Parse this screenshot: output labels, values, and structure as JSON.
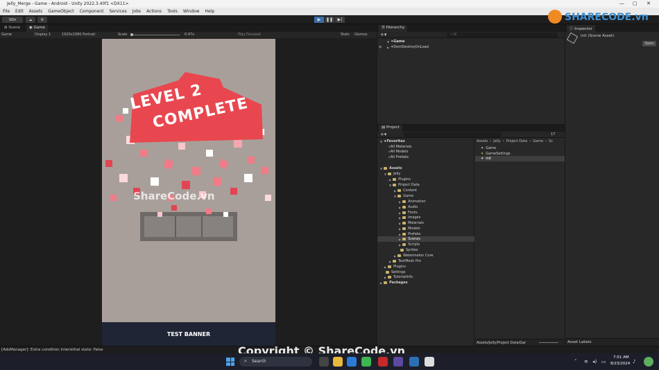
{
  "window": {
    "title": "Jelly_Merge - Game - Android - Unity 2022.3.40f1 <DX11>"
  },
  "menu": [
    "File",
    "Edit",
    "Assets",
    "GameObject",
    "Component",
    "Services",
    "Jobs",
    "Actions",
    "Tools",
    "Window",
    "Help"
  ],
  "toolbar": {
    "account": "ND"
  },
  "scene_tabs": {
    "scene": "Scene",
    "game": "Game"
  },
  "game_bar": {
    "mode": "Game",
    "display": "Display 1",
    "resolution": "1920x1080 Portrait",
    "scale_label": "Scale",
    "scale_value": "0.47x",
    "play_focused": "Play Focused",
    "stats": "Stats",
    "gizmos": "Gizmos"
  },
  "game_view": {
    "banner": "TEST BANNER",
    "level_line1": "LEVEL 2",
    "level_line2": "COMPLETE",
    "watermark": "ShareCode.vn"
  },
  "hierarchy": {
    "title": "Hierarchy",
    "search_placeholder": "All",
    "items": [
      "Game",
      "DontDestroyOnLoad"
    ]
  },
  "inspector": {
    "title": "Inspector",
    "asset": "init (Scene Asset)",
    "open_label": "Open",
    "labels_title": "Asset Labels"
  },
  "project": {
    "title": "Project",
    "count": "17",
    "favorites_label": "Favorites",
    "favorites": [
      "All Materials",
      "All Models",
      "All Prefabs"
    ],
    "assets_label": "Assets",
    "tree": [
      "Jelly",
      "Plugins",
      "Project Data",
      "Content",
      "Game",
      "Animation",
      "Audio",
      "Fonts",
      "Images",
      "Materials",
      "Models",
      "Prefabs",
      "Scenes",
      "Scripts",
      "Sprites",
      "Watermelon Core",
      "TextMesh Pro",
      "Plugins",
      "Settings",
      "TutorialInfo"
    ],
    "packages_label": "Packages",
    "breadcrumb": [
      "Assets",
      "Jelly",
      "Project Data",
      "Game",
      "Sc"
    ],
    "files": [
      "Game",
      "GameSettings",
      "init"
    ],
    "footer_path": "Assets/Jelly/Project Data/Gar"
  },
  "status": {
    "message": "[AdsManager]: Extra condition interstitial state: False"
  },
  "footer_watermark": "Copyright © ShareCode.vn",
  "logo": {
    "text": "SHARECODE.vn"
  },
  "taskbar": {
    "search": "Search",
    "time": "7:51 AM",
    "date": "8/23/2024"
  },
  "colors": {
    "accent": "#e8474f",
    "selection": "#2c5d87",
    "folder": "#c8b26a"
  }
}
